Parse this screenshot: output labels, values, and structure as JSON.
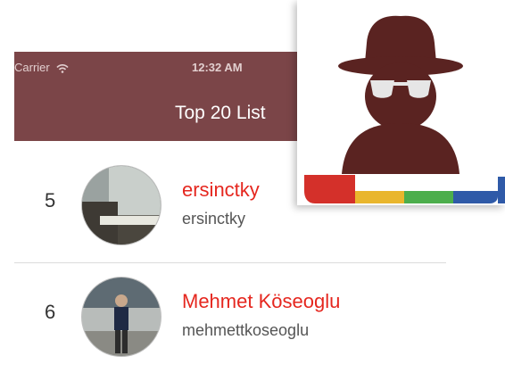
{
  "status_bar": {
    "carrier": "Carrier",
    "time": "12:32 AM"
  },
  "nav": {
    "title": "Top 20 List"
  },
  "list": {
    "rows": [
      {
        "rank": "5",
        "display_name": "ersinctky",
        "username": "ersinctky"
      },
      {
        "rank": "6",
        "display_name": "Mehmet Köseoglu",
        "username": "mehmettkoseoglu"
      }
    ]
  },
  "colors": {
    "header": "#7b4548",
    "name": "#e5271f",
    "icon_figure": "#5a2321",
    "stripe_red": "#d4302a",
    "stripe_yellow": "#e9b62d",
    "stripe_green": "#4cae4c",
    "stripe_blue": "#2f5aa8"
  },
  "icons": {
    "app": "spy-incognito-icon",
    "wifi": "wifi-icon"
  }
}
